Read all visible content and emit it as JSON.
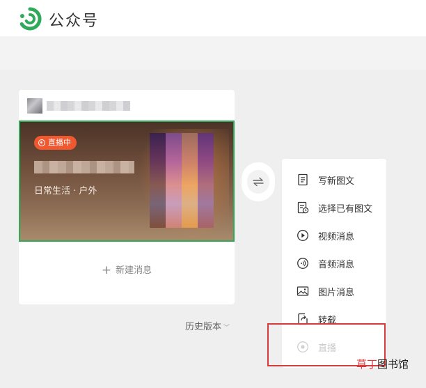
{
  "header": {
    "brand": "公众号",
    "logo_icon": "wechat-mp-logo-icon",
    "accent": "#2faa59"
  },
  "card": {
    "account_name": "",
    "cover": {
      "live_badge": "直播中",
      "subtitle": "日常生活 · 户外"
    },
    "new_message_label": "新建消息",
    "history_label": "历史版本"
  },
  "swap": {
    "icon": "swap-arrows-icon"
  },
  "menu": {
    "items": [
      {
        "label": "写新图文",
        "icon": "document-icon",
        "enabled": true
      },
      {
        "label": "选择已有图文",
        "icon": "document-clock-icon",
        "enabled": true
      },
      {
        "label": "视频消息",
        "icon": "play-circle-icon",
        "enabled": true
      },
      {
        "label": "音频消息",
        "icon": "audio-circle-icon",
        "enabled": true
      },
      {
        "label": "图片消息",
        "icon": "image-icon",
        "enabled": true
      },
      {
        "label": "转载",
        "icon": "repost-icon",
        "enabled": true
      },
      {
        "label": "直播",
        "icon": "live-circle-icon",
        "enabled": false
      }
    ]
  },
  "watermark": {
    "red_part": "草丁",
    "black_part": "图书馆"
  },
  "colors": {
    "live_badge": "#f0582f",
    "highlight": "#d83a3a",
    "selected_border": "#2faa59"
  }
}
